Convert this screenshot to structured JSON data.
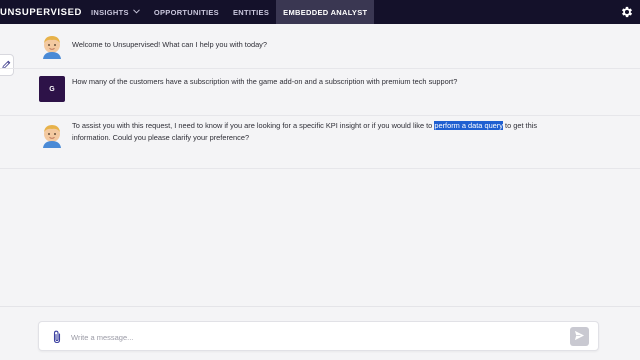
{
  "app": {
    "brand": "UNSUPERVISED"
  },
  "nav": {
    "items": [
      {
        "label": "INSIGHTS",
        "has_dropdown": true,
        "active": false
      },
      {
        "label": "OPPORTUNITIES",
        "has_dropdown": false,
        "active": false
      },
      {
        "label": "ENTITIES",
        "has_dropdown": false,
        "active": false
      },
      {
        "label": "EMBEDDED ANALYST",
        "has_dropdown": false,
        "active": true
      }
    ],
    "settings_icon": "gear-icon"
  },
  "chat": {
    "messages": [
      {
        "sender": "assistant",
        "avatar_icon": "memoji-avatar",
        "text": "Welcome to Unsupervised! What can I help you with today?"
      },
      {
        "sender": "user",
        "avatar_letter": "G",
        "text": "How many of the customers have a subscription with the game add-on and a subscription with premium tech support?"
      },
      {
        "sender": "assistant",
        "avatar_icon": "memoji-avatar",
        "text_before": "To assist you with this request, I need to know if you are looking for a specific KPI insight or if you would like to",
        "text_highlight": "perform a data query",
        "text_after": "to get this information. Could you please clarify your preference?"
      }
    ]
  },
  "composer": {
    "placeholder": "Write a message...",
    "attach_icon": "paperclip-icon",
    "send_icon": "send-icon"
  },
  "colors": {
    "nav_bg": "#14112a",
    "nav_active": "#3a3752",
    "user_avatar_bg": "#2d1248",
    "highlight": "#1f5fd1",
    "page_bg": "#f4f4f6"
  }
}
